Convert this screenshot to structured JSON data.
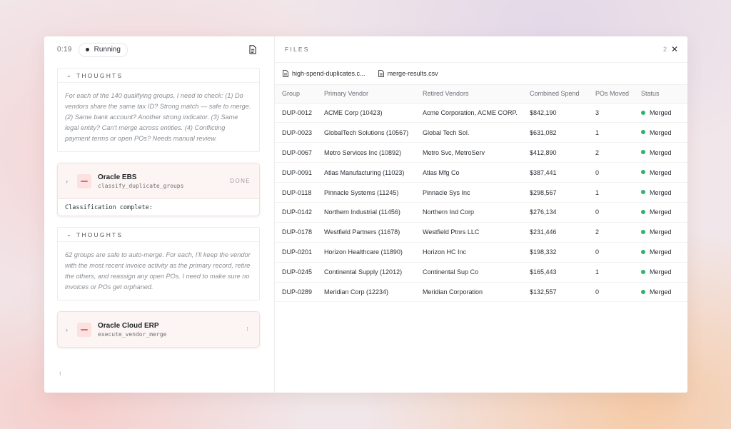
{
  "left": {
    "timer": "0:19",
    "status": "Running",
    "thoughts_title": "THOUGHTS",
    "thoughts": [
      "For each of the 140 qualifying groups, I need to check: (1) Do vendors share the same tax ID? Strong match — safe to merge. (2) Same bank account? Another strong indicator. (3) Same legal entity? Can't merge across entities. (4) Conflicting payment terms or open POs? Needs manual review.",
      "62 groups are safe to auto-merge. For each, I'll keep the vendor with the most recent invoice activity as the primary record, retire the others, and reassign any open POs. I need to make sure no invoices or POs get orphaned."
    ],
    "tools": [
      {
        "name": "Oracle EBS",
        "function": "classify_duplicate_groups",
        "status": "DONE",
        "result": "Classification complete:"
      },
      {
        "name": "Oracle Cloud ERP",
        "function": "execute_vendor_merge",
        "status": "running"
      }
    ]
  },
  "files": {
    "title": "FILES",
    "count": "2",
    "tabs": [
      "high-spend-duplicates.c...",
      "merge-results.csv"
    ],
    "columns": [
      "Group",
      "Primary Vendor",
      "Retired Vendors",
      "Combined Spend",
      "POs Moved",
      "Status"
    ],
    "rows": [
      [
        "DUP-0012",
        "ACME Corp (10423)",
        "Acme Corporation, ACME CORP.",
        "$842,190",
        "3",
        "Merged"
      ],
      [
        "DUP-0023",
        "GlobalTech Solutions (10567)",
        "Global Tech Sol.",
        "$631,082",
        "1",
        "Merged"
      ],
      [
        "DUP-0067",
        "Metro Services Inc (10892)",
        "Metro Svc, MetroServ",
        "$412,890",
        "2",
        "Merged"
      ],
      [
        "DUP-0091",
        "Atlas Manufacturing (11023)",
        "Atlas Mfg Co",
        "$387,441",
        "0",
        "Merged"
      ],
      [
        "DUP-0118",
        "Pinnacle Systems (11245)",
        "Pinnacle Sys Inc",
        "$298,567",
        "1",
        "Merged"
      ],
      [
        "DUP-0142",
        "Northern Industrial (11456)",
        "Northern Ind Corp",
        "$276,134",
        "0",
        "Merged"
      ],
      [
        "DUP-0178",
        "Westfield Partners (11678)",
        "Westfield Ptnrs LLC",
        "$231,446",
        "2",
        "Merged"
      ],
      [
        "DUP-0201",
        "Horizon Healthcare (11890)",
        "Horizon HC Inc",
        "$198,332",
        "0",
        "Merged"
      ],
      [
        "DUP-0245",
        "Continental Supply (12012)",
        "Continental Sup Co",
        "$165,443",
        "1",
        "Merged"
      ],
      [
        "DUP-0289",
        "Meridian Corp (12234)",
        "Meridian Corporation",
        "$132,557",
        "0",
        "Merged"
      ]
    ]
  },
  "colors": {
    "merged": "#2fb36b",
    "tool_accent": "#e56a6a"
  }
}
